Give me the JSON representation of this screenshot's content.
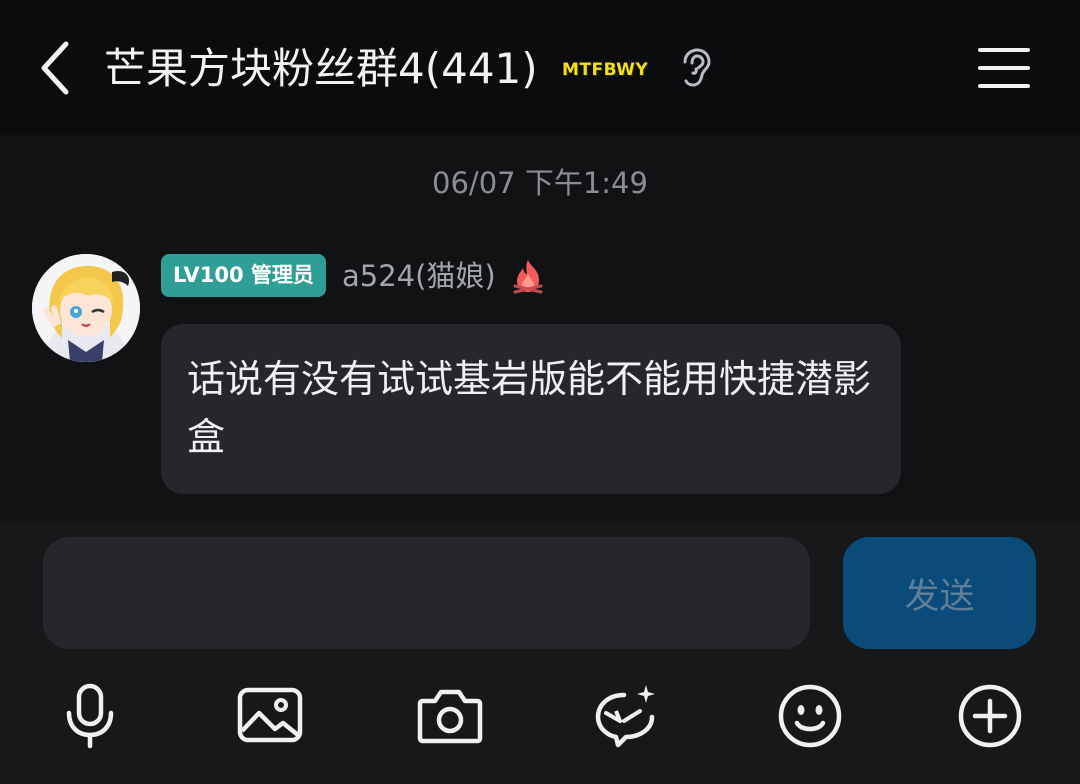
{
  "header": {
    "title": "芒果方块粉丝群4(441)",
    "badge_text": "MTFBWY"
  },
  "chat": {
    "timestamp": "06/07 下午1:49",
    "messages": [
      {
        "level_badge": "LV100 管理员",
        "username": "a524(猫娘)",
        "text": "话说有没有试试基岩版能不能用快捷潜影盒"
      }
    ]
  },
  "composer": {
    "input_value": "",
    "send_label": "发送"
  },
  "toolbar": {
    "icons": [
      "microphone-icon",
      "image-icon",
      "camera-icon",
      "ai-sparkle-icon",
      "emoji-icon",
      "plus-icon"
    ]
  },
  "colors": {
    "background": "#111214",
    "header": "#0b0c0e",
    "bubble": "#25272b",
    "admin_badge": "#2f9e96",
    "send_button": "#0a4b79"
  }
}
